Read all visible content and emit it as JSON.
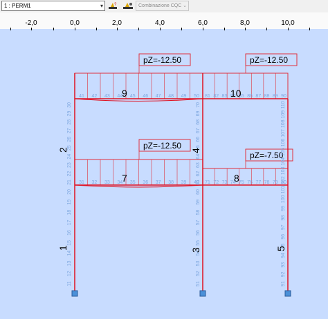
{
  "toolbar": {
    "load_case": "1 : PERM1",
    "combination": "Combinazione CQC",
    "icons": [
      "load-case-edit-icon",
      "load-case-view-icon"
    ]
  },
  "ruler": {
    "ticks": [
      "-2,0",
      "0,0",
      "2,0",
      "4,0",
      "6,0",
      "8,0",
      "10,0"
    ]
  },
  "loads": [
    {
      "id": "load-beam-9",
      "label": "pZ=-12.50"
    },
    {
      "id": "load-beam-10",
      "label": "pZ=-12.50"
    },
    {
      "id": "load-beam-7",
      "label": "pZ=-12.50"
    },
    {
      "id": "load-beam-8",
      "label": "pZ=-7.50"
    }
  ],
  "elements": {
    "columns": [
      "1",
      "2",
      "3",
      "4",
      "5"
    ],
    "beams": [
      "7",
      "8",
      "9",
      "10"
    ]
  },
  "node_numbers": {
    "col1_lower": [
      "11",
      "12",
      "13",
      "14",
      "15",
      "16",
      "17",
      "18",
      "19",
      "20"
    ],
    "col1_upper": [
      "21",
      "22",
      "23",
      "24",
      "25",
      "26",
      "27",
      "28",
      "29",
      "30"
    ],
    "beam9": [
      "41",
      "42",
      "43",
      "44",
      "45",
      "46",
      "47",
      "48",
      "49",
      "50"
    ],
    "beam7": [
      "31",
      "32",
      "33",
      "34",
      "35",
      "36",
      "37",
      "38",
      "39",
      "40"
    ],
    "col3_lower": [
      "51",
      "52",
      "53",
      "54",
      "55",
      "56",
      "57",
      "58",
      "59",
      "60"
    ],
    "col3_upper": [
      "61",
      "62",
      "63",
      "64",
      "65",
      "66",
      "67",
      "68",
      "69",
      "70"
    ],
    "beam8": [
      "71",
      "72",
      "73",
      "74",
      "75",
      "76",
      "77",
      "78",
      "79",
      "80"
    ],
    "beam10": [
      "81",
      "82",
      "83",
      "84",
      "85",
      "86",
      "87",
      "88",
      "89",
      "90"
    ],
    "col5": [
      "91",
      "92",
      "93",
      "94",
      "95",
      "96",
      "97",
      "98",
      "99",
      "100",
      "101",
      "102",
      "103",
      "104",
      "105",
      "106",
      "107",
      "108",
      "109",
      "110"
    ]
  },
  "colors": {
    "background": "#c8dcff",
    "frame": "#e01020",
    "load": "#e0303c",
    "node_text": "#7fa8e0",
    "support": "#4a90d8"
  }
}
